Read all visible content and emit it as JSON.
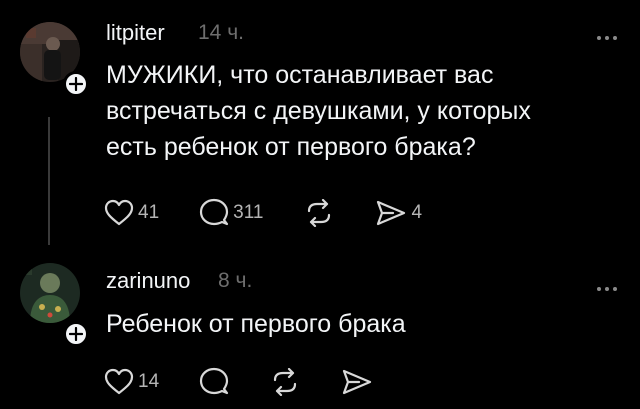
{
  "posts": [
    {
      "username": "litpiter",
      "time": "14 ч.",
      "text_lines": [
        "МУЖИКИ, что останавливает вас",
        "встречаться с девушками, у которых",
        "есть ребенок от первого брака?"
      ],
      "likes": "41",
      "replies": "311",
      "shares": "4"
    },
    {
      "username": "zarinuno",
      "time": "8 ч.",
      "text_lines": [
        "Ребенок от первого брака"
      ],
      "likes": "14"
    }
  ],
  "icons": [
    "heart-icon",
    "comment-icon",
    "repost-icon",
    "share-icon",
    "more-icon",
    "follow-plus-icon"
  ]
}
